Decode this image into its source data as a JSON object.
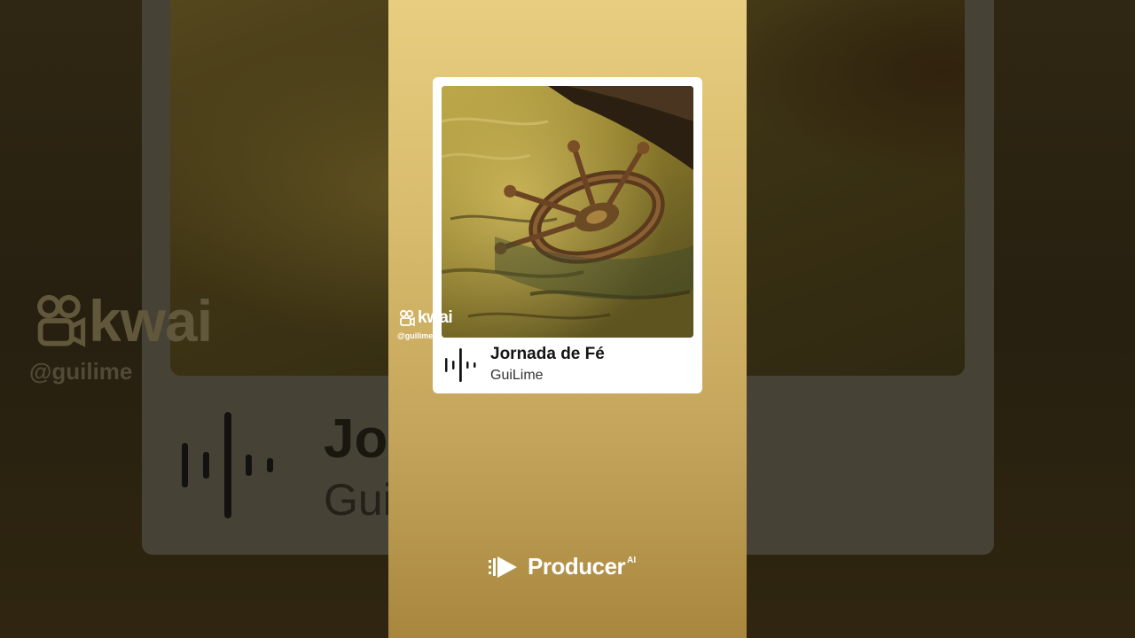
{
  "track": {
    "title": "Jornada de Fé",
    "artist": "GuiLime"
  },
  "background_preview": {
    "title_fragment": "Jo",
    "artist_fragment": "Gui"
  },
  "watermark": {
    "brand": "kwai",
    "handle": "@guilime",
    "icon": "kwai-logo-icon"
  },
  "branding": {
    "name": "Producer",
    "superscript": "AI",
    "icon": "producer-play-icon"
  },
  "colors": {
    "frame_top": "#e8cd80",
    "frame_bottom": "#a8863e",
    "card": "#ffffff",
    "title_text": "#141414"
  }
}
